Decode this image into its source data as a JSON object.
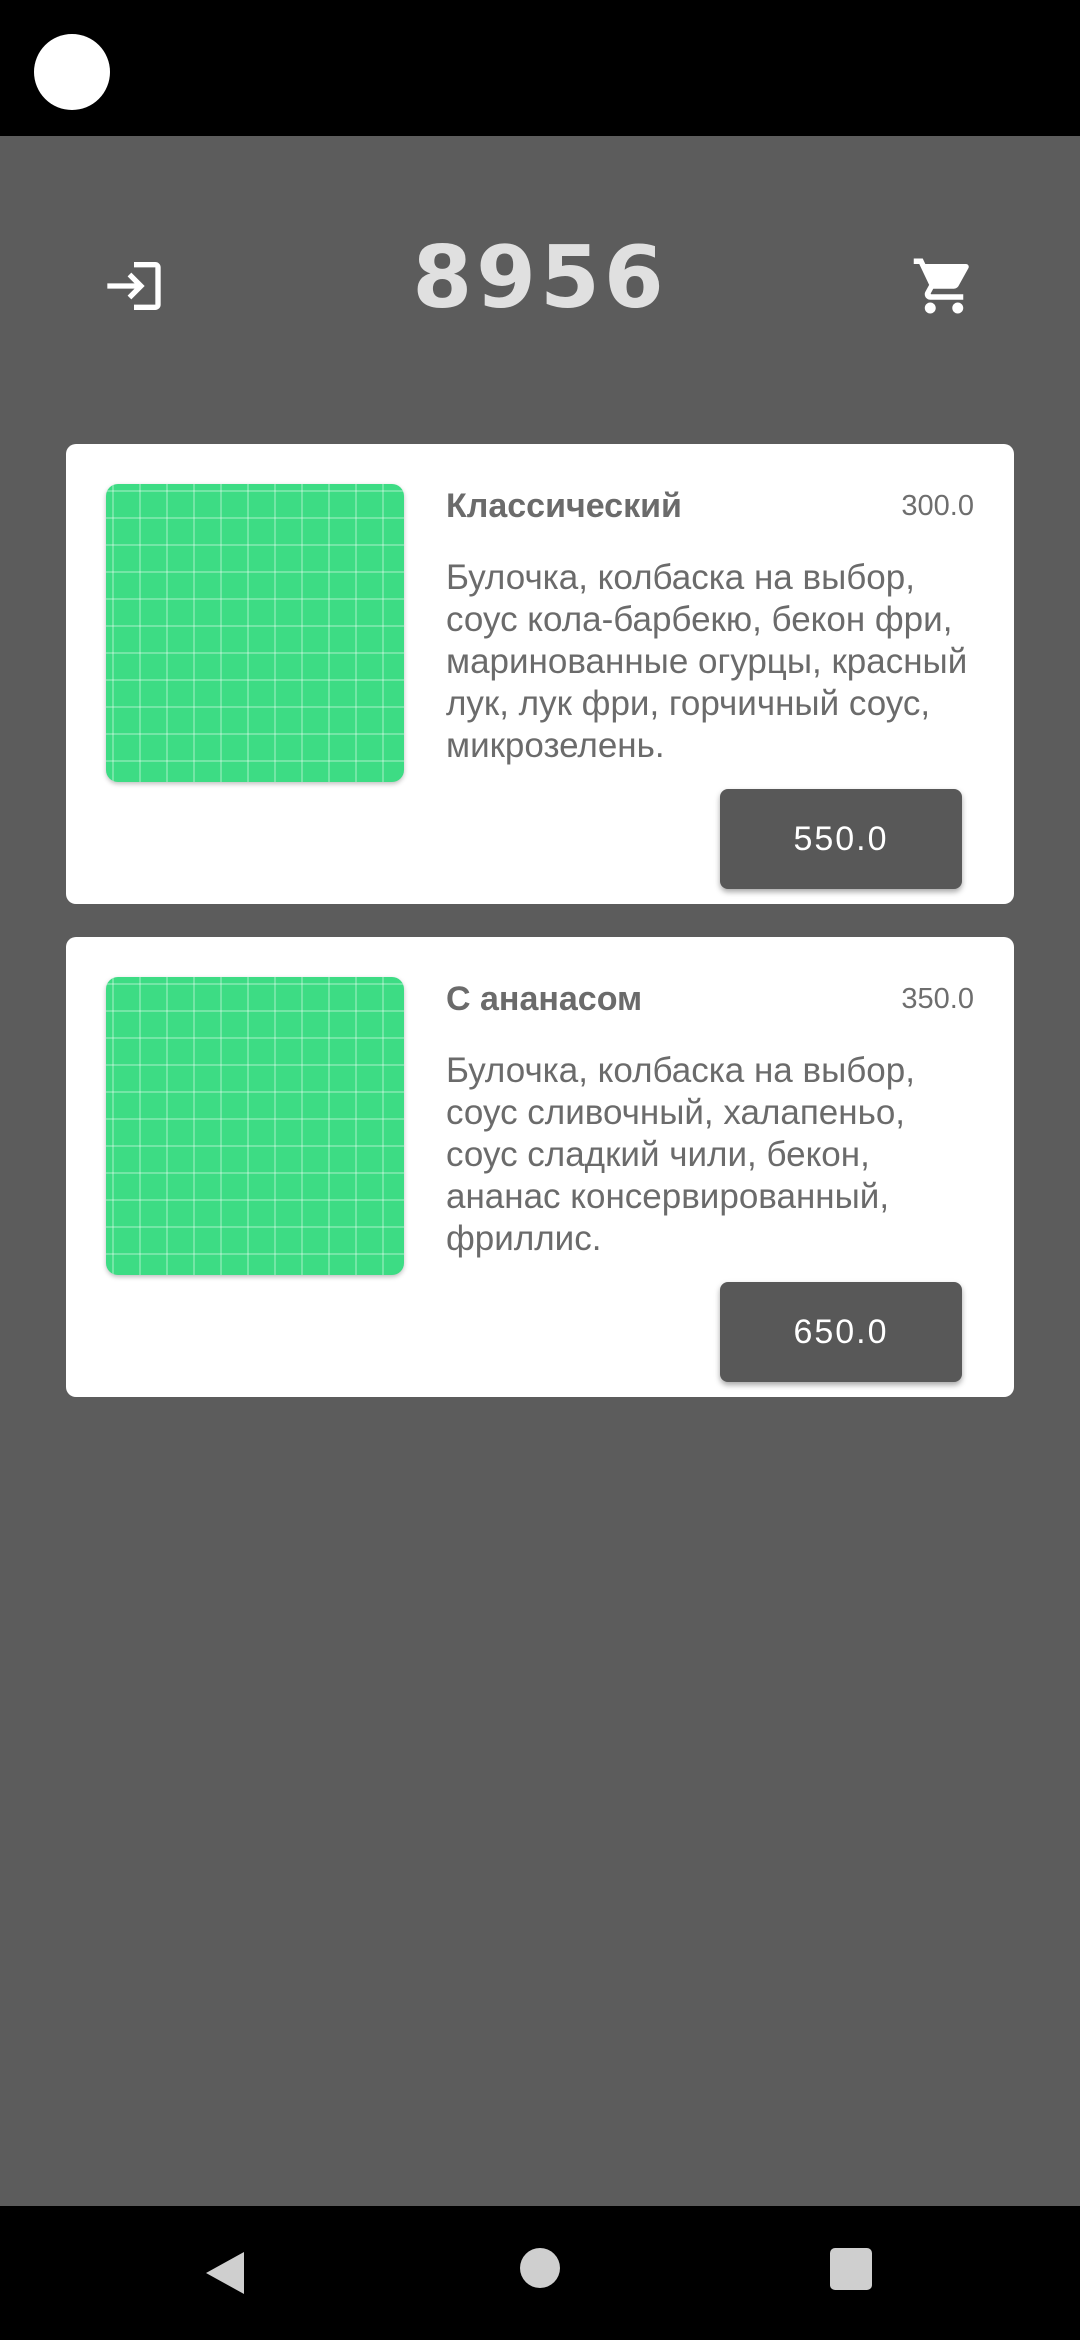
{
  "header": {
    "title": "8956",
    "login_icon": "login-icon",
    "cart_icon": "cart-icon"
  },
  "menu": {
    "items": [
      {
        "name": "Классический",
        "weight": "300.0",
        "description": "Булочка, колбаска на выбор, соус кола-барбекю, бекон фри, маринованные огурцы, красный лук, лук фри, горчичный соус, микрозелень.",
        "price": "550.0",
        "image_color": "#3ddc84"
      },
      {
        "name": "С ананасом",
        "weight": "350.0",
        "description": "Булочка, колбаска на выбор, соус сливочный, халапеньо, соус сладкий чили, бекон, ананас консервированный, фриллис.",
        "price": "650.0",
        "image_color": "#3ddc84"
      }
    ]
  },
  "colors": {
    "background": "#5c5c5c",
    "card": "#ffffff",
    "button": "#585858",
    "accent_green": "#3ddc84"
  },
  "nav": {
    "back_icon": "back-triangle-icon",
    "home_icon": "home-circle-icon",
    "recents_icon": "recents-square-icon"
  }
}
